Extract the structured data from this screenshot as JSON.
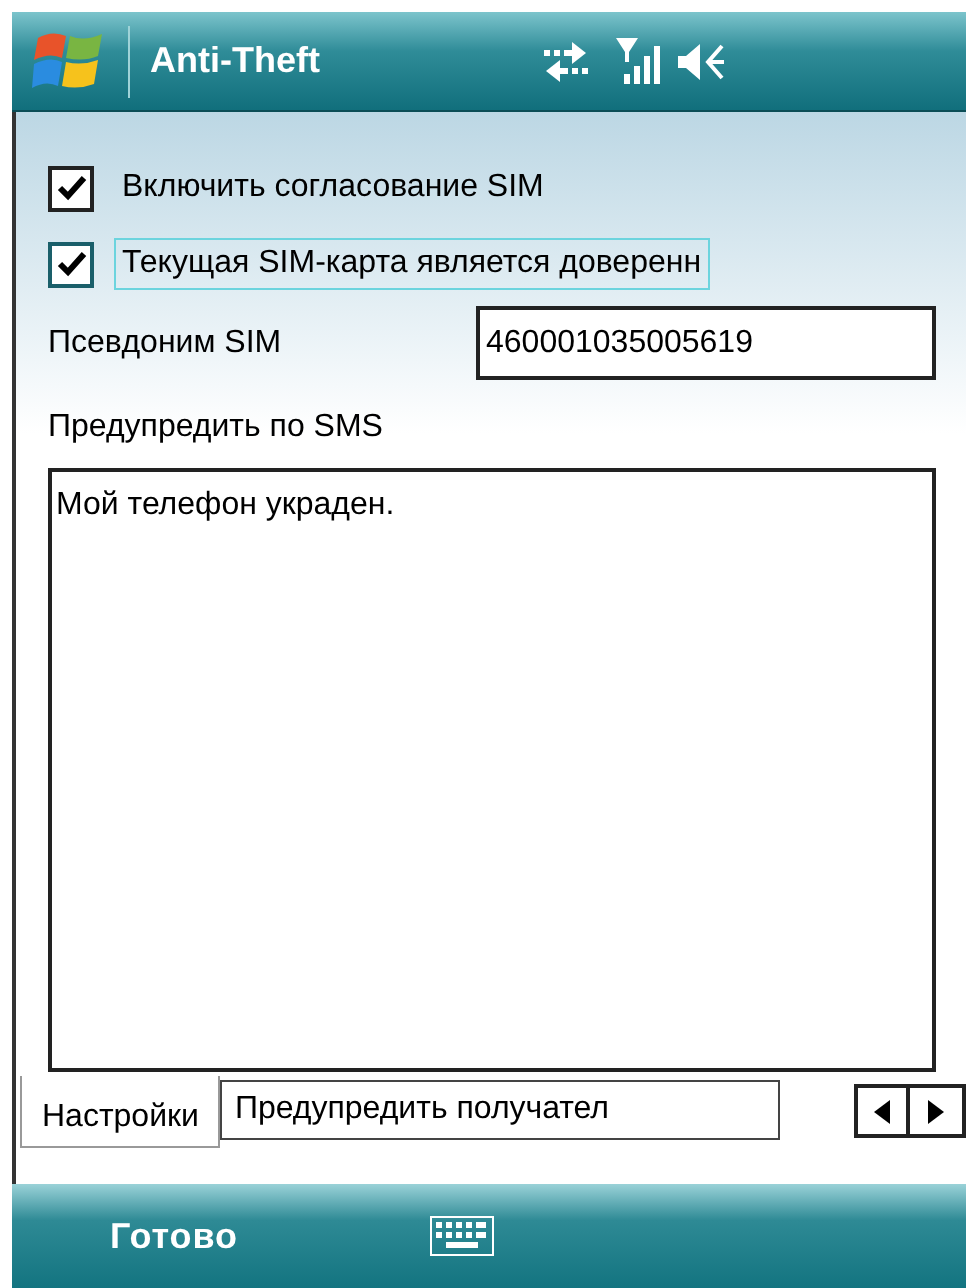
{
  "title_bar": {
    "title": "Anti-Theft"
  },
  "options": [
    {
      "label": "Включить согласование SIM",
      "checked": true,
      "focused": false
    },
    {
      "label": "Текущая SIM-карта является доверенн",
      "checked": true,
      "focused": true
    }
  ],
  "sim_alias": {
    "label": "Псевдоним SIM",
    "value": "460001035005619"
  },
  "sms_alert": {
    "label": "Предупредить по SMS",
    "value": "Мой телефон украден."
  },
  "tabs": [
    {
      "label": "Настройки",
      "selected": true
    },
    {
      "label": "Предупредить получател",
      "selected": false
    }
  ],
  "softkeys": {
    "left": "Готово"
  }
}
